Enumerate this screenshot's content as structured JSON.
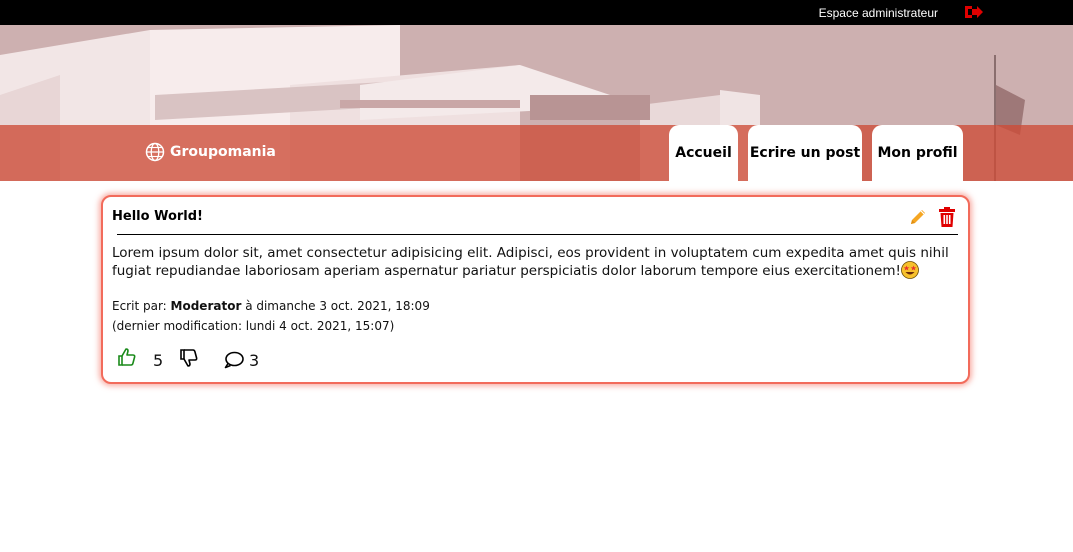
{
  "topbar": {
    "admin_label": "Espace administrateur",
    "logout_icon": "logout-icon"
  },
  "header": {
    "logo_icon": "globe-icon",
    "logo_text": "Groupomania",
    "tabs": [
      {
        "label": "Accueil"
      },
      {
        "label": "Ecrire un post"
      },
      {
        "label": "Mon profil"
      }
    ]
  },
  "post": {
    "title": "Hello World!",
    "body": "Lorem ipsum dolor sit, amet consectetur adipisicing elit. Adipisci, eos provident in voluptatem cum expedita amet quis nihil fugiat repudiandae laboriosam aperiam aspernatur pariatur perspiciatis dolor laborum tempore eius exercitationem!",
    "emoji": "star-struck-emoji",
    "written_by_prefix": "Ecrit par:",
    "author": "Moderator",
    "date_text": "à dimanche 3 oct. 2021, 18:09",
    "modified_text": "(dernier modification: lundi 4 oct. 2021, 15:07)",
    "likes": "5",
    "comments": "3",
    "edit_icon": "pencil-icon",
    "delete_icon": "trash-icon"
  },
  "colors": {
    "accent": "#f26b5b",
    "band": "#cd4b37",
    "like": "#1a8a1a",
    "edit": "#f5a623",
    "delete": "#e00000"
  }
}
